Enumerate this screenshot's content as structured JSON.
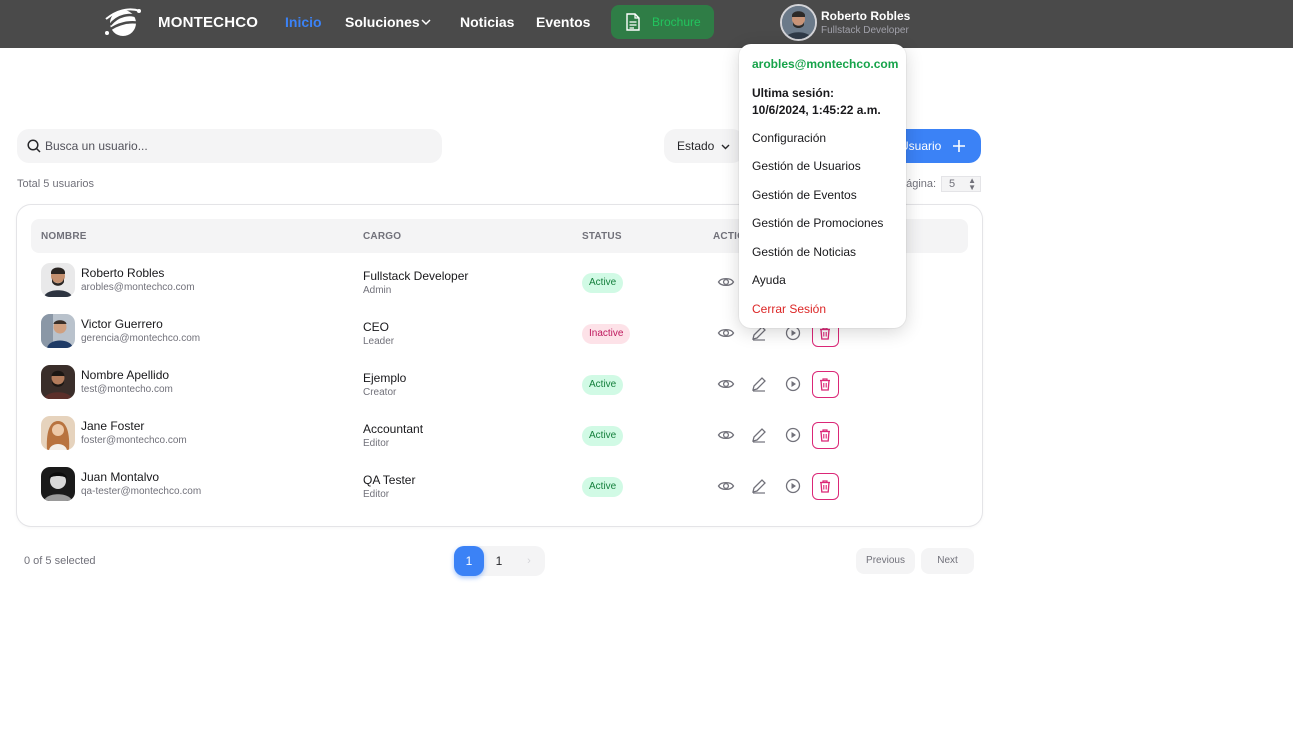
{
  "navbar": {
    "brand": "MONTECHCO",
    "links": [
      {
        "label": "Inicio",
        "active": true
      },
      {
        "label": "Soluciones"
      },
      {
        "label": "Noticias"
      },
      {
        "label": "Eventos"
      }
    ],
    "brochure_label": "Brochure",
    "user": {
      "name": "Roberto Robles",
      "role": "Fullstack Developer"
    }
  },
  "toolbar": {
    "search_placeholder": "Busca un usuario...",
    "status_filter_label": "Estado",
    "add_button_label": "Usuario",
    "total_text": "Total 5 usuarios",
    "per_page_label": "página:",
    "per_page_value": "5"
  },
  "table": {
    "columns": [
      "NOMBRE",
      "CARGO",
      "STATUS",
      "ACTIO"
    ],
    "rows": [
      {
        "name": "Roberto Robles",
        "email": "arobles@montechco.com",
        "role": "Fullstack Developer",
        "role_sub": "Admin",
        "status": "Active"
      },
      {
        "name": "Victor Guerrero",
        "email": "gerencia@montechco.com",
        "role": "CEO",
        "role_sub": "Leader",
        "status": "Inactive"
      },
      {
        "name": "Nombre Apellido",
        "email": "test@montecho.com",
        "role": "Ejemplo",
        "role_sub": "Creator",
        "status": "Active"
      },
      {
        "name": "Jane Foster",
        "email": "foster@montechco.com",
        "role": "Accountant",
        "role_sub": "Editor",
        "status": "Active"
      },
      {
        "name": "Juan Montalvo",
        "email": "qa-tester@montechco.com",
        "role": "QA Tester",
        "role_sub": "Editor",
        "status": "Active"
      }
    ]
  },
  "footer": {
    "selected_text": "0 of 5 selected",
    "current_page": "1",
    "page_numbers": [
      "1"
    ],
    "next_arrow": "›",
    "previous_label": "Previous",
    "next_label": "Next"
  },
  "dropdown": {
    "email": "arobles@montechco.com",
    "session_label": "Ultima sesión:",
    "session_value": "10/6/2024, 1:45:22 a.m.",
    "items": [
      "Configuración",
      "Gestión de Usuarios",
      "Gestión de Eventos",
      "Gestión de Promociones",
      "Gestión de Noticias",
      "Ayuda",
      "Cerrar Sesión"
    ]
  },
  "colors": {
    "navbar_bg": "#4a4a4a",
    "accent": "#3b82f6",
    "success": "#16a34a",
    "danger": "#dc2626",
    "delete_border": "#db2777"
  },
  "icons": [
    "logo-icon",
    "chevron-down-icon",
    "document-icon",
    "search-icon",
    "plus-icon",
    "eye-icon",
    "edit-icon",
    "play-icon",
    "trash-icon"
  ]
}
